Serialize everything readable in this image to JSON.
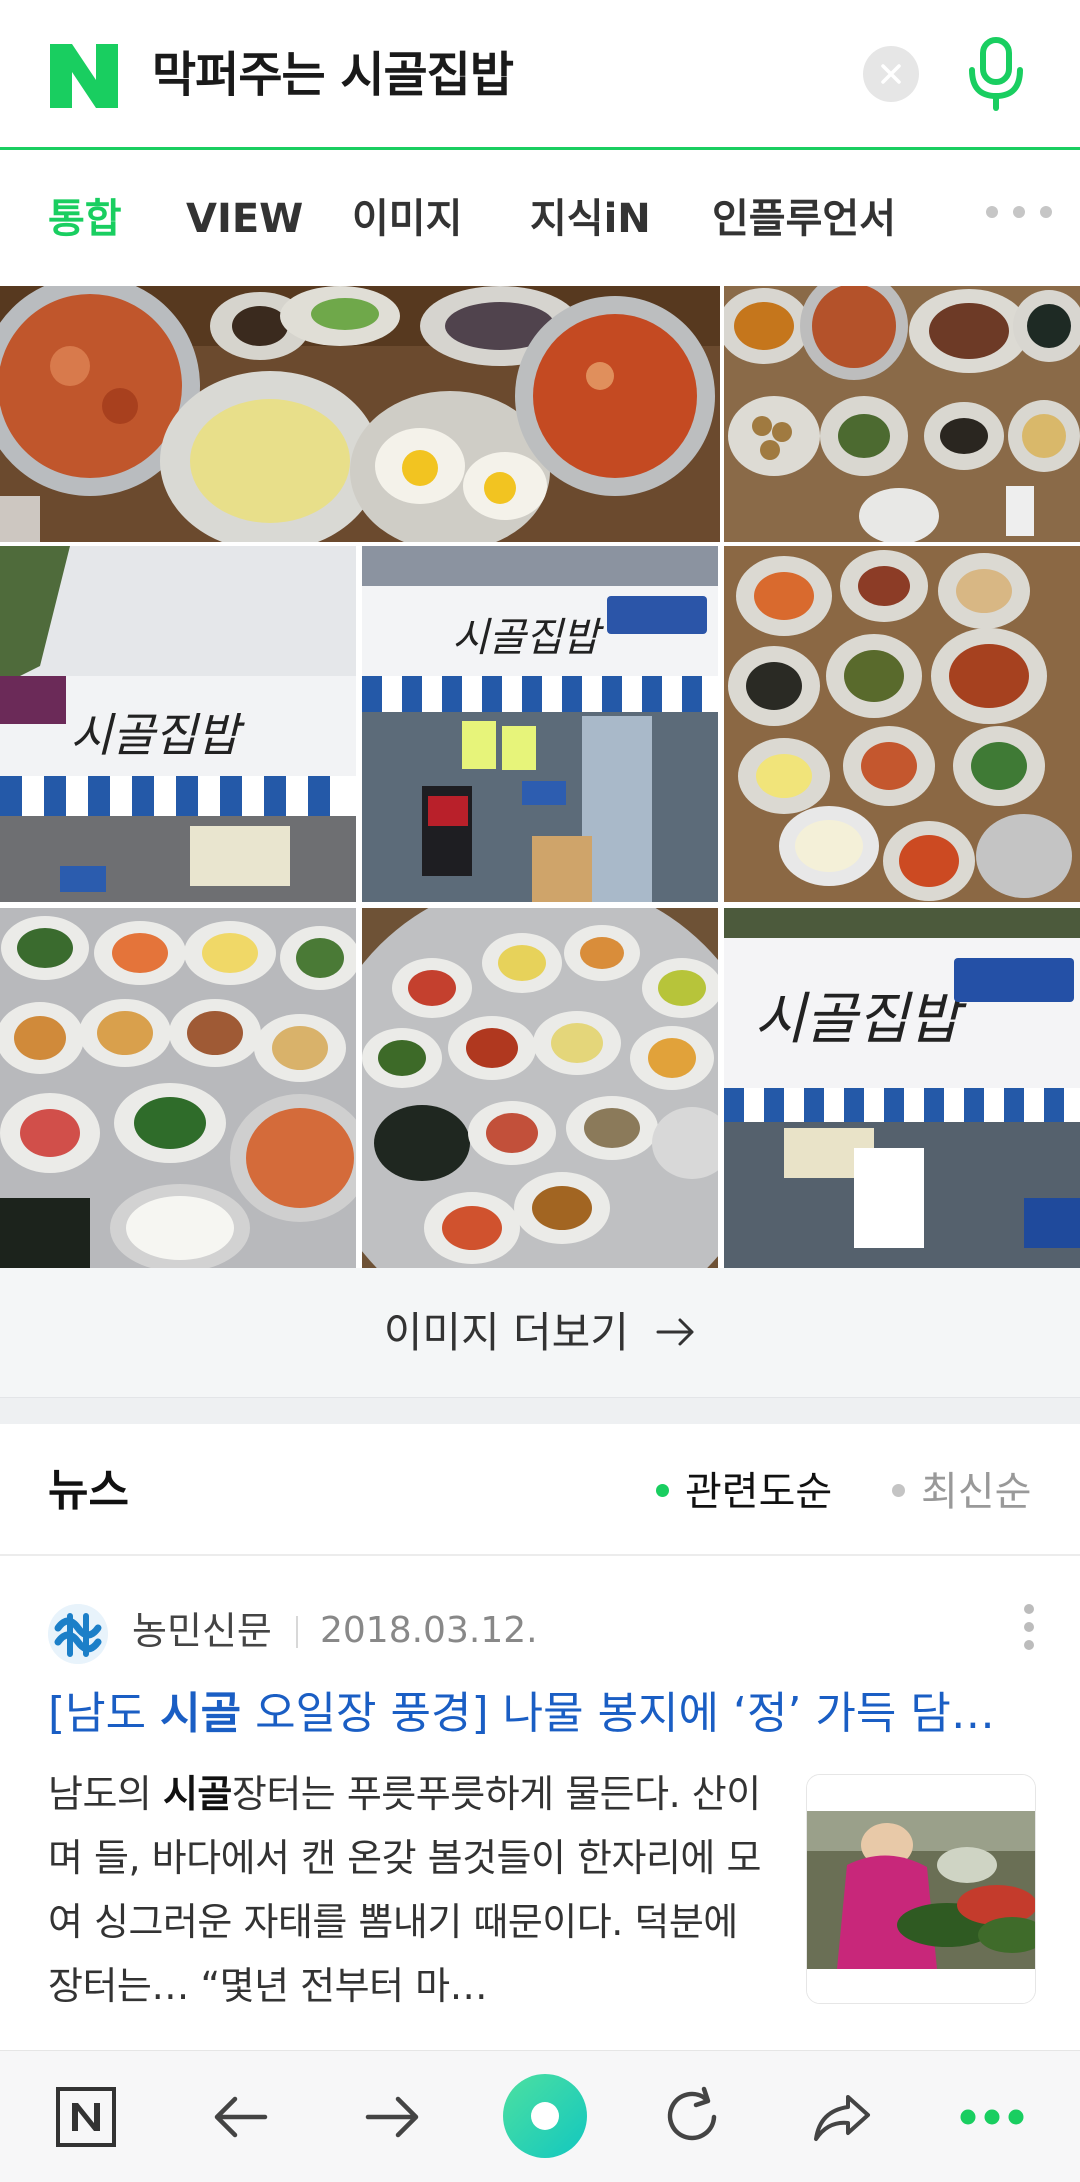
{
  "header": {
    "logo": "N",
    "query": "막퍼주는 시골집밥",
    "icons": {
      "clear": "clear-icon",
      "mic": "microphone-icon"
    },
    "accent_color": "#19ce60"
  },
  "tabs": [
    {
      "label": "통합",
      "active": true
    },
    {
      "label": "VIEW",
      "active": false
    },
    {
      "label": "이미지",
      "active": false
    },
    {
      "label": "지식iN",
      "active": false
    },
    {
      "label": "인플루언서",
      "active": false
    }
  ],
  "images": {
    "items": [
      "korean-side-dishes-photo",
      "table-set-photo",
      "restaurant-storefront-photo",
      "restaurant-entrance-photo",
      "banchan-table-photo",
      "banchan-tray-photo",
      "side-dish-tray-photo",
      "restaurant-signboard-photo"
    ],
    "more_label": "이미지 더보기"
  },
  "news": {
    "title": "뉴스",
    "sort": {
      "relevance": "관련도순",
      "latest": "최신순",
      "selected": "관련도순"
    },
    "article": {
      "press": "농민신문",
      "date": "2018.03.12.",
      "headline_pre": "[남도 ",
      "headline_bold": "시골",
      "headline_post": " 오일장 풍경] 나물 봉지에 ‘정’ 가득 담…",
      "summary_pre": "남도의 ",
      "summary_bold": "시골",
      "summary_post": "장터는 푸릇푸릇하게 물든다. 산이며 들, 바다에서 캔 온갖 봄것들이 한자리에 모여 싱그러운 자태를 뽐내기 때문이다. 덕분에 장터는… “몇년 전부터 마…"
    }
  },
  "bottom_bar": {
    "icons": [
      "naver-home-icon",
      "back-arrow-icon",
      "forward-arrow-icon",
      "green-dot-icon",
      "refresh-icon",
      "share-icon",
      "more-dots-icon"
    ]
  }
}
